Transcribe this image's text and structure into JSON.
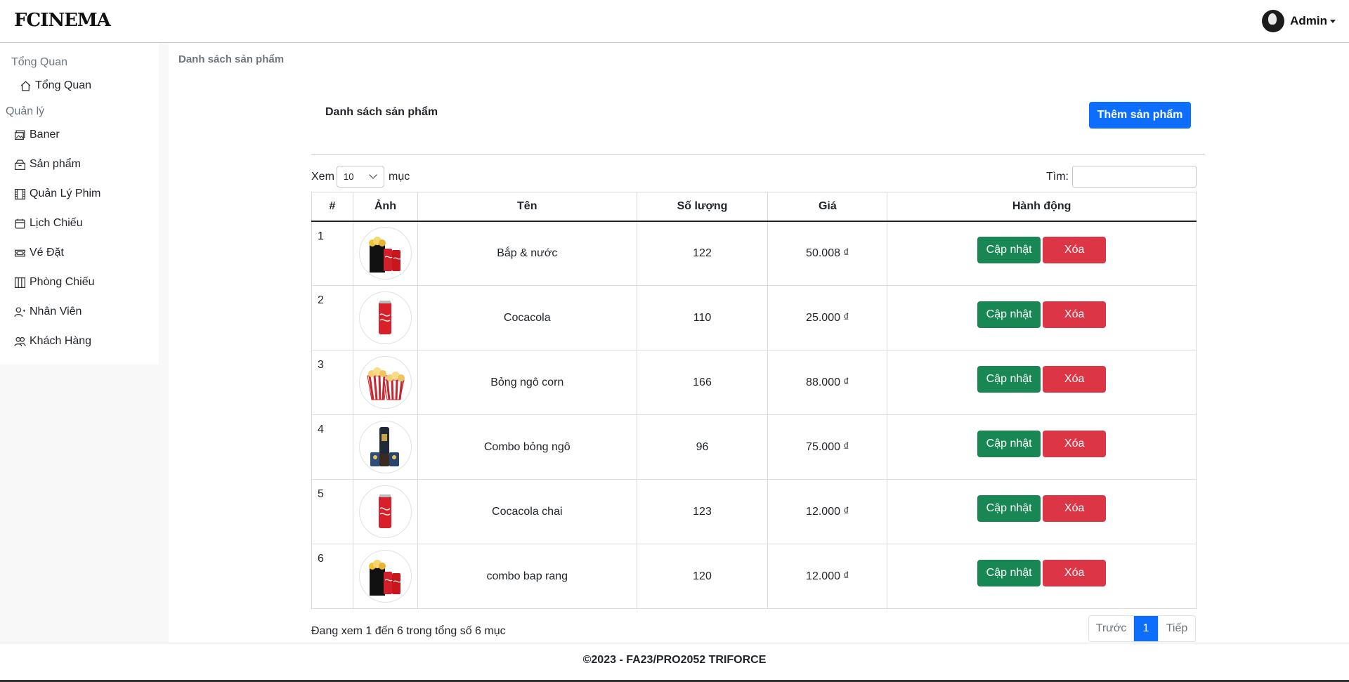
{
  "brand": "FCINEMA",
  "user": {
    "name": "Admin"
  },
  "sidebar": {
    "section_overview": "Tổng Quan",
    "section_manage": "Quản lý",
    "items": [
      {
        "label": "Tổng Quan",
        "icon": "house-icon"
      },
      {
        "label": "Baner",
        "icon": "images-icon"
      },
      {
        "label": "Sản phẩm",
        "icon": "box-icon"
      },
      {
        "label": "Quản Lý Phim",
        "icon": "film-icon"
      },
      {
        "label": "Lịch Chiếu",
        "icon": "calendar-icon"
      },
      {
        "label": "Vé Đặt",
        "icon": "ticket-icon"
      },
      {
        "label": "Phòng Chiếu",
        "icon": "columns-icon"
      },
      {
        "label": "Nhân Viên",
        "icon": "person-icon"
      },
      {
        "label": "Khách Hàng",
        "icon": "people-icon"
      }
    ]
  },
  "breadcrumb": "Danh sách sản phẩm",
  "card": {
    "title": "Danh sách sản phẩm",
    "add_button": "Thêm sản phẩm"
  },
  "table_controls": {
    "length_prefix": "Xem",
    "length_value": "10",
    "length_suffix": "mục",
    "search_label": "Tìm:",
    "search_value": ""
  },
  "table": {
    "headers": [
      "#",
      "Ảnh",
      "Tên",
      "Số lượng",
      "Giá",
      "Hành động"
    ],
    "rows": [
      {
        "idx": "1",
        "image": "popcorn-combo",
        "name": "Bắp & nước",
        "qty": "122",
        "price": "50.008 ₫"
      },
      {
        "idx": "2",
        "image": "coca-can",
        "name": "Cocacola",
        "qty": "110",
        "price": "25.000 ₫"
      },
      {
        "idx": "3",
        "image": "popcorn",
        "name": "Bỏng ngô corn",
        "qty": "166",
        "price": "88.000 ₫"
      },
      {
        "idx": "4",
        "image": "combo-dark",
        "name": "Combo bỏng ngô",
        "qty": "96",
        "price": "75.000 ₫"
      },
      {
        "idx": "5",
        "image": "coca-can",
        "name": "Cocacola chai",
        "qty": "123",
        "price": "12.000 ₫"
      },
      {
        "idx": "6",
        "image": "popcorn-combo",
        "name": "combo bap rang",
        "qty": "120",
        "price": "12.000 ₫"
      }
    ],
    "update_label": "Cập nhật",
    "delete_label": "Xóa"
  },
  "table_info": "Đang xem 1 đến 6 trong tổng số 6 mục",
  "pagination": {
    "prev": "Trước",
    "current": "1",
    "next": "Tiếp"
  },
  "footer": "©2023 - FA23/PRO2052 TRIFORCE",
  "colors": {
    "primary": "#0d6efd",
    "success": "#198754",
    "danger": "#dc3545"
  }
}
